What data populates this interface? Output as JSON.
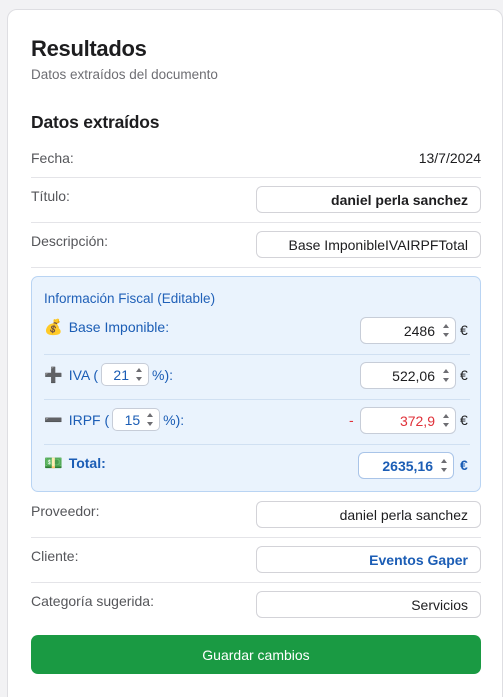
{
  "header": {
    "title": "Resultados",
    "subtitle": "Datos extraídos del documento"
  },
  "section_title": "Datos extraídos",
  "fields": {
    "fecha": {
      "label": "Fecha:",
      "value": "13/7/2024"
    },
    "titulo": {
      "label": "Título:",
      "value": "daniel perla sanchez"
    },
    "descripcion": {
      "label": "Descripción:",
      "value": "Base ImponibleIVAIRPFTotal"
    },
    "proveedor": {
      "label": "Proveedor:",
      "value": "daniel perla sanchez"
    },
    "cliente": {
      "label": "Cliente:",
      "value": "Eventos Gaper"
    },
    "categoria": {
      "label": "Categoría sugerida:",
      "value": "Servicios"
    }
  },
  "fiscal": {
    "title": "Información Fiscal (Editable)",
    "base": {
      "icon": "money-bag-icon",
      "icon_glyph": "💰",
      "label": "Base Imponible:",
      "value": "2486",
      "currency": "€"
    },
    "iva": {
      "icon": "plus-icon",
      "icon_glyph": "➕",
      "label_prefix": "IVA (",
      "rate": "21",
      "label_suffix": "%):",
      "value": "522,06",
      "currency": "€"
    },
    "irpf": {
      "icon": "minus-icon",
      "icon_glyph": "➖",
      "label_prefix": "IRPF (",
      "rate": "15",
      "label_suffix": "%):",
      "sign": "-",
      "value": "372,9",
      "currency": "€"
    },
    "total": {
      "icon": "banknote-icon",
      "icon_glyph": "💵",
      "label": "Total:",
      "value": "2635,16",
      "currency": "€"
    }
  },
  "actions": {
    "save_label": "Guardar cambios"
  },
  "colors": {
    "accent_blue": "#1b5db5",
    "save_green": "#1a9a43",
    "negative_red": "#e0323a"
  }
}
